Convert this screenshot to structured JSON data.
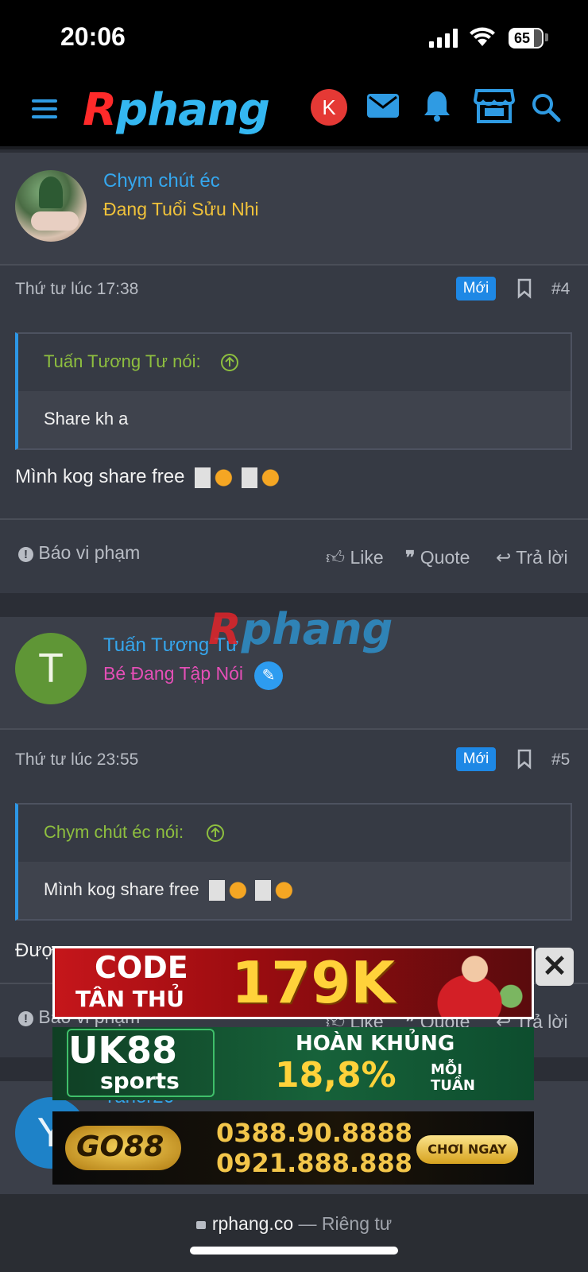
{
  "status_bar": {
    "time": "20:06",
    "battery": "65"
  },
  "header": {
    "logo_first": "R",
    "logo_rest": "phang",
    "avatar_letter": "K",
    "icons": [
      "menu-icon",
      "mail-icon",
      "bell-icon",
      "store-icon",
      "search-icon"
    ]
  },
  "posts": [
    {
      "author": "Chym chút éc",
      "title": "Đang Tuổi Sửu Nhi",
      "title_color": "#f0c23a",
      "time": "Thứ tư lúc 17:38",
      "badge": "Mới",
      "number": "#4",
      "quote_author": "Tuấn Tương Tư nói:",
      "quote_text": "Share kh a",
      "message": "Mình kog share free"
    },
    {
      "author": "Tuấn Tương Tư",
      "avatar_letter": "T",
      "title": "Bé Đang Tập Nói",
      "title_color": "#e44fb6",
      "time": "Thứ tư lúc 23:55",
      "badge": "Mới",
      "number": "#5",
      "quote_author": "Chym chút éc nói:",
      "quote_text": "Mình kog share free",
      "message": "Được"
    },
    {
      "author": "Yaner26",
      "avatar_letter": "Y"
    }
  ],
  "actions": {
    "report": "Báo vi phạm",
    "like": "Like",
    "quote": "Quote",
    "reply": "Trả lời"
  },
  "watermark": {
    "first": "R",
    "rest": "phang"
  },
  "ads": {
    "ad1_line1": "CODE",
    "ad1_line2": "TÂN THỦ",
    "ad1_amount": "179K",
    "ad2_brand": "UK88",
    "ad2_sub": "sports",
    "ad2_line1": "HOÀN KHỦNG",
    "ad2_line2": "18,8%",
    "ad2_line3": "MỖI TUẦN",
    "ad3_brand": "GO88",
    "ad3_phone1": "0388.90.8888",
    "ad3_phone2": "0921.888.888",
    "ad3_button": "CHƠI NGAY",
    "close": "✕"
  },
  "browser": {
    "domain": "rphang.co",
    "separator": " — ",
    "privacy": "Riêng tư"
  }
}
